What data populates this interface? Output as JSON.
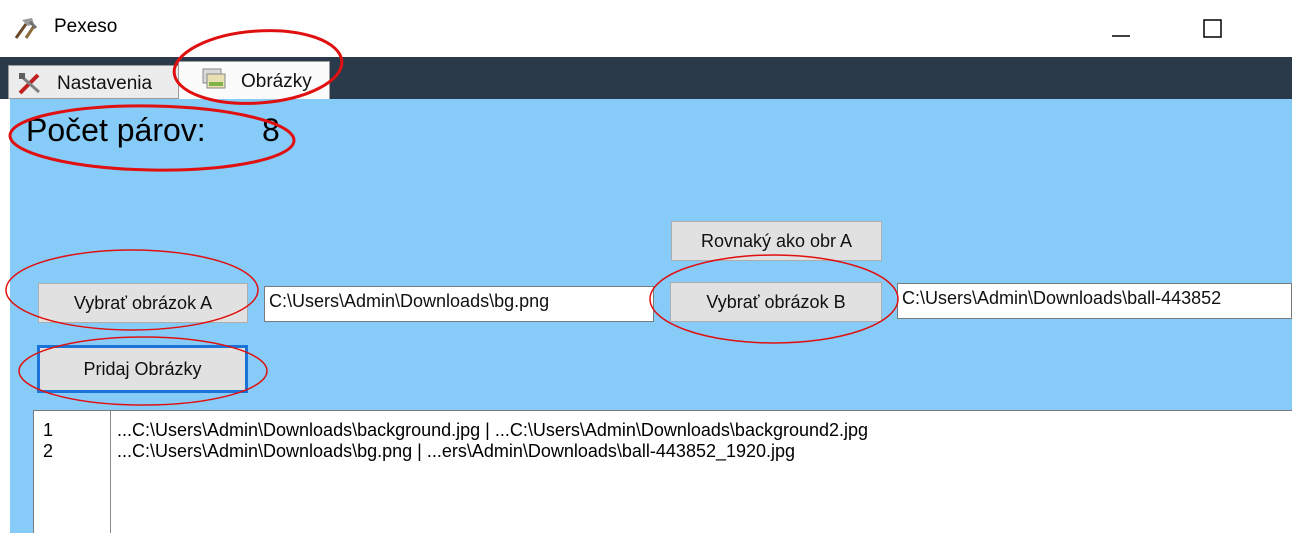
{
  "window": {
    "title": "Pexeso"
  },
  "tabs": [
    {
      "label": "Nastavenia",
      "icon": "tools-icon"
    },
    {
      "label": "Obrázky",
      "icon": "images-icon",
      "selected": true
    }
  ],
  "pairs": {
    "label": "Počet párov:",
    "value": "8"
  },
  "buttons": {
    "same_as_a": "Rovnaký ako obr A",
    "select_a": "Vybrať obrázok A",
    "select_b": "Vybrať obrázok B",
    "add_images": "Pridaj Obrázky"
  },
  "fields": {
    "path_a": "C:\\Users\\Admin\\Downloads\\bg.png",
    "path_b": "C:\\Users\\Admin\\Downloads\\ball-443852"
  },
  "list": {
    "rows": [
      {
        "num": "1",
        "text": "...C:\\Users\\Admin\\Downloads\\background.jpg   |   ...C:\\Users\\Admin\\Downloads\\background2.jpg"
      },
      {
        "num": "2",
        "text": "...C:\\Users\\Admin\\Downloads\\bg.png   |   ...ers\\Admin\\Downloads\\ball-443852_1920.jpg"
      }
    ]
  },
  "colors": {
    "content_bg": "#87ccf8",
    "tabstrip_bg": "#2b3a4b",
    "annotation_red": "#e01010",
    "focus_blue": "#1a73d9"
  }
}
